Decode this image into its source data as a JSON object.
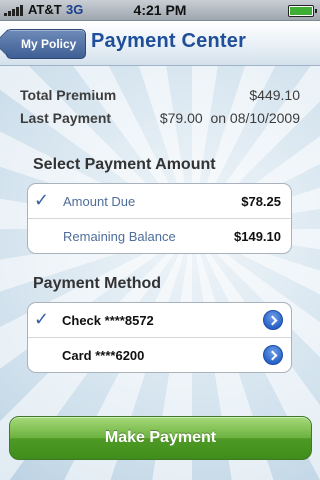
{
  "status_bar": {
    "carrier": "AT&T",
    "network": "3G",
    "time": "4:21 PM"
  },
  "nav": {
    "back_label": "My Policy",
    "title": "Payment Center"
  },
  "summary": {
    "total_premium_label": "Total Premium",
    "total_premium_value": "$449.10",
    "last_payment_label": "Last Payment",
    "last_payment_value": "$79.00  on 08/10/2009"
  },
  "amount_section": {
    "title": "Select Payment Amount",
    "options": [
      {
        "label": "Amount Due",
        "value": "$78.25",
        "selected": true
      },
      {
        "label": "Remaining Balance",
        "value": "$149.10",
        "selected": false
      }
    ]
  },
  "method_section": {
    "title": "Payment Method",
    "options": [
      {
        "label": "Check ****8572",
        "selected": true
      },
      {
        "label": "Card ****6200",
        "selected": false
      }
    ]
  },
  "make_payment_label": "Make Payment",
  "icons": {
    "check": "checkmark-icon",
    "disclosure": "chevron-right-circle-icon",
    "back": "back-arrow-button"
  },
  "colors": {
    "nav_title": "#1f4e9a",
    "back_button": "#4a6aa0",
    "make_payment": "#5ea734",
    "checkmark": "#3a5fa6"
  }
}
